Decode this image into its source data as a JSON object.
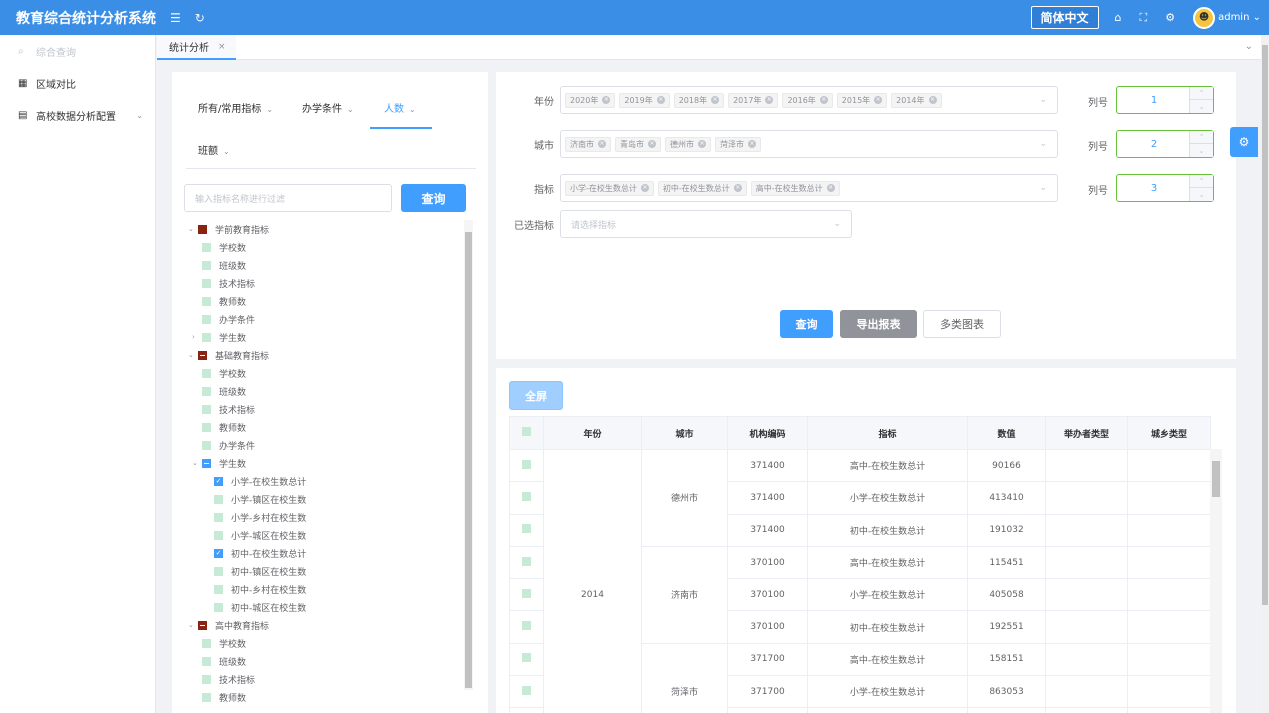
{
  "header": {
    "app_title": "教育综合统计分析系统",
    "language": "简体中文",
    "username": "admin"
  },
  "icons": [
    "menu-icon",
    "refresh-icon",
    "home-icon",
    "fullscreen-icon",
    "settings-icon",
    "avatar-icon",
    "chevron-down-icon",
    "search-icon"
  ],
  "sidebar": {
    "search": "综合查询",
    "items": [
      {
        "label": "区域对比"
      },
      {
        "label": "高校数据分析配置"
      }
    ]
  },
  "tabs": [
    {
      "label": "统计分析"
    }
  ],
  "left": {
    "categories": [
      "所有/常用指标",
      "办学条件",
      "人数",
      "班额"
    ],
    "filter_placeholder": "输入指标名称进行过滤",
    "query_label": "查询",
    "tree": [
      {
        "label": "学前教育指标"
      },
      {
        "label": "学校数"
      },
      {
        "label": "班级数"
      },
      {
        "label": "技术指标"
      },
      {
        "label": "教师数"
      },
      {
        "label": "办学条件"
      },
      {
        "label": "学生数"
      },
      {
        "label": "基础教育指标"
      },
      {
        "label": "学校数"
      },
      {
        "label": "班级数"
      },
      {
        "label": "技术指标"
      },
      {
        "label": "教师数"
      },
      {
        "label": "办学条件"
      },
      {
        "label": "学生数"
      },
      {
        "label": "小学-在校生数总计"
      },
      {
        "label": "小学-镇区在校生数"
      },
      {
        "label": "小学-乡村在校生数"
      },
      {
        "label": "小学-城区在校生数"
      },
      {
        "label": "初中-在校生数总计"
      },
      {
        "label": "初中-镇区在校生数"
      },
      {
        "label": "初中-乡村在校生数"
      },
      {
        "label": "初中-城区在校生数"
      },
      {
        "label": "高中教育指标"
      },
      {
        "label": "学校数"
      },
      {
        "label": "班级数"
      },
      {
        "label": "技术指标"
      },
      {
        "label": "教师数"
      }
    ]
  },
  "form": {
    "year_label": "年份",
    "years": [
      "2020年",
      "2019年",
      "2018年",
      "2017年",
      "2016年",
      "2015年",
      "2014年"
    ],
    "city_label": "城市",
    "cities": [
      "济南市",
      "青岛市",
      "德州市",
      "菏泽市"
    ],
    "indicator_label": "指标",
    "indicators": [
      "小学-在校生数总计",
      "初中-在校生数总计",
      "高中-在校生数总计"
    ],
    "selected_label": "已选指标",
    "selected_placeholder": "请选择指标",
    "column_label": "列号",
    "columns": [
      "1",
      "2",
      "3"
    ],
    "query_btn": "查询",
    "export_btn": "导出报表",
    "chart_btn": "多类图表"
  },
  "table": {
    "fullscreen_btn": "全屏",
    "headers": [
      "年份",
      "城市",
      "机构编码",
      "指标",
      "数值",
      "举办者类型",
      "城乡类型"
    ],
    "year": "2014",
    "city_groups": [
      "德州市",
      "济南市",
      "菏泽市"
    ],
    "rows": [
      {
        "code": "371400",
        "indicator": "高中-在校生数总计",
        "value": "90166"
      },
      {
        "code": "371400",
        "indicator": "小学-在校生数总计",
        "value": "413410"
      },
      {
        "code": "371400",
        "indicator": "初中-在校生数总计",
        "value": "191032"
      },
      {
        "code": "370100",
        "indicator": "高中-在校生数总计",
        "value": "115451"
      },
      {
        "code": "370100",
        "indicator": "小学-在校生数总计",
        "value": "405058"
      },
      {
        "code": "370100",
        "indicator": "初中-在校生数总计",
        "value": "192551"
      },
      {
        "code": "371700",
        "indicator": "高中-在校生数总计",
        "value": "158151"
      },
      {
        "code": "371700",
        "indicator": "小学-在校生数总计",
        "value": "863053"
      }
    ]
  }
}
